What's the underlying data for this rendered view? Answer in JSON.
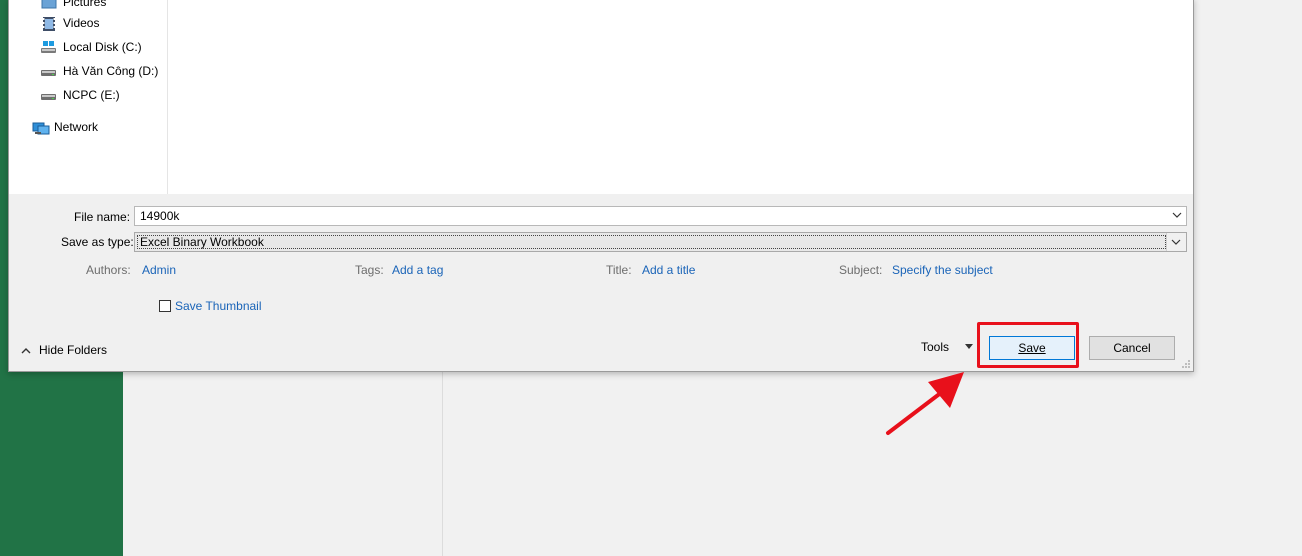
{
  "nav": {
    "items": [
      {
        "label": "Pictures",
        "icon": "pictures-folder-icon"
      },
      {
        "label": "Videos",
        "icon": "videos-folder-icon"
      },
      {
        "label": "Local Disk (C:)",
        "icon": "local-disk-icon"
      },
      {
        "label": "Hà Văn Công (D:)",
        "icon": "drive-icon"
      },
      {
        "label": "NCPC (E:)",
        "icon": "drive-icon"
      },
      {
        "label": "Network",
        "icon": "network-icon"
      }
    ]
  },
  "form": {
    "file_name_label": "File name:",
    "file_name_value": "14900k",
    "save_type_label": "Save as type:",
    "save_type_value": "Excel Binary Workbook"
  },
  "meta": {
    "authors_label": "Authors:",
    "authors_value": "Admin",
    "tags_label": "Tags:",
    "tags_value": "Add a tag",
    "title_label": "Title:",
    "title_value": "Add a title",
    "subject_label": "Subject:",
    "subject_value": "Specify the subject",
    "thumbnail_label": "Save Thumbnail",
    "thumbnail_checked": false
  },
  "footer": {
    "hide_folders": "Hide Folders",
    "tools": "Tools",
    "save": "Save",
    "cancel": "Cancel"
  },
  "colors": {
    "excel_green": "#217346",
    "highlight_red": "#e8101b",
    "link_blue": "#1a64b8"
  }
}
